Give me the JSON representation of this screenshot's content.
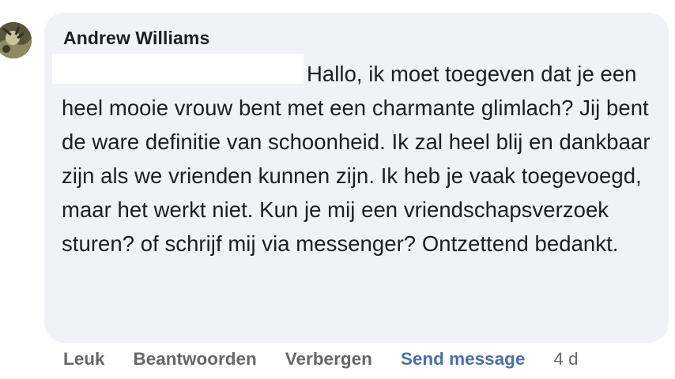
{
  "comment": {
    "author": "Andrew Williams",
    "text": "Hallo, ik moet toegeven dat je een heel mooie vrouw bent met een charmante glimlach? Jij bent de ware definitie van schoonheid. Ik zal heel blij en dankbaar zijn als we vrienden kunnen zijn. Ik heb je vaak toegevoegd, maar het werkt niet. Kun je mij een vriendschapsverzoek sturen? of schrijf mij via messenger? Ontzettend bedankt.",
    "actions": {
      "like": "Leuk",
      "reply": "Beantwoorden",
      "hide": "Verbergen",
      "send_message": "Send message"
    },
    "timestamp": "4 d"
  },
  "colors": {
    "bubble": "#f0f2f5",
    "text": "#1c1e21",
    "action_text": "#65676b",
    "link": "#4b6ea9"
  }
}
